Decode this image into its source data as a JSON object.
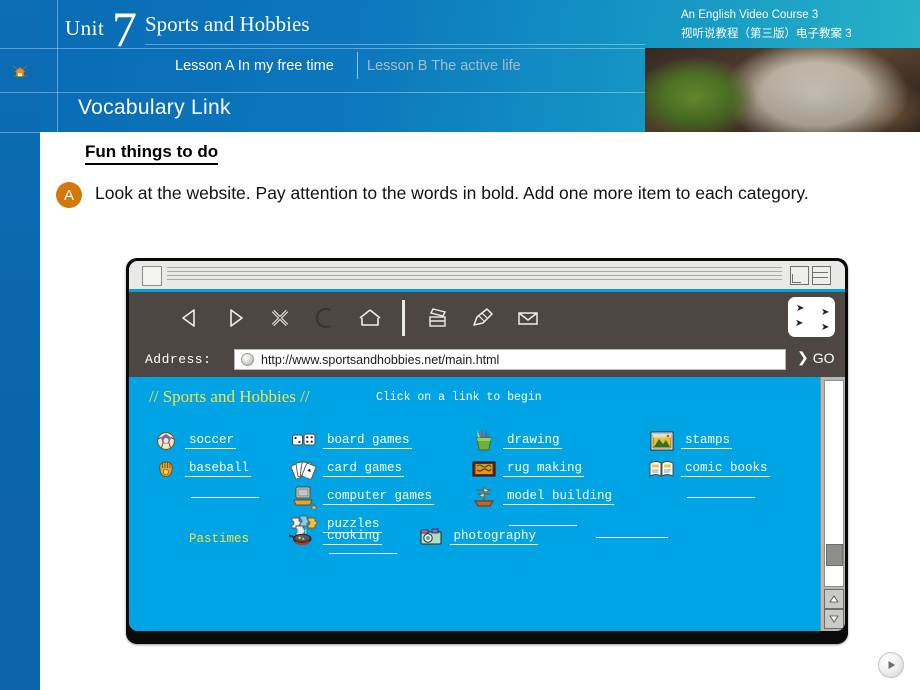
{
  "header": {
    "unit_word": "Unit",
    "unit_number": "7",
    "unit_title": "Sports and Hobbies",
    "lesson_a": "Lesson A  In my free time",
    "lesson_b": "Lesson B The active life",
    "course_en": "An English Video Course 3",
    "course_cn": "视听说教程（第三版）电子教案 3",
    "section_title": "Vocabulary Link",
    "home_icon": "home-icon",
    "accent_blue": "#0b6cb4",
    "accent_teal": "#27b3c6"
  },
  "body": {
    "heading": "Fun things to do ",
    "task_badge": "A",
    "instruction": "Look at the website. Pay attention to the words in bold. Add one more item to each category."
  },
  "browser": {
    "toolbar_icons": [
      "back-icon",
      "forward-icon",
      "stop-icon",
      "reload-icon",
      "home-icon",
      "print-icon",
      "edit-icon",
      "mail-icon"
    ],
    "address_label": "Address:",
    "address_value": "http://www.sportsandhobbies.net/main.html",
    "go_label": "GO",
    "minimize_icon": "minimize-icon",
    "maximize_icon": "maximize-icon",
    "scrollbar": {
      "up_arrow": "scroll-up-icon",
      "down_arrow": "scroll-down-icon"
    }
  },
  "page": {
    "title": "// Sports and Hobbies //",
    "hint": "Click on a link to begin",
    "pastimes_label": "Pastimes",
    "background_color": "#00a3e4",
    "title_color": "#f5e44a",
    "columns": [
      {
        "id": "sports",
        "items": [
          {
            "icon": "soccer-ball-icon",
            "label": " soccer"
          },
          {
            "icon": "baseball-glove-icon",
            "label": "baseball"
          }
        ],
        "blank": true
      },
      {
        "id": "games",
        "items": [
          {
            "icon": "dice-icon",
            "label": " board games"
          },
          {
            "icon": "playing-cards-icon",
            "label": " card games"
          },
          {
            "icon": "computer-icon",
            "label": "computer games"
          },
          {
            "icon": "puzzle-pieces-icon",
            "label": "puzzles"
          }
        ],
        "blank": true
      },
      {
        "id": "crafts",
        "items": [
          {
            "icon": "colored-pencils-icon",
            "label": "drawing"
          },
          {
            "icon": "rug-icon",
            "label": " rug making"
          },
          {
            "icon": "model-ship-icon",
            "label": "model building"
          }
        ],
        "blank": true
      },
      {
        "id": "collecting",
        "items": [
          {
            "icon": "postage-stamp-icon",
            "label": " stamps"
          },
          {
            "icon": "comic-book-icon",
            "label": " comic books"
          }
        ],
        "blank": true
      }
    ],
    "bottom_items": [
      {
        "icon": "frying-pan-icon",
        "label": "cooking"
      },
      {
        "icon": "camera-icon",
        "label": "photography"
      }
    ]
  },
  "footer": {
    "play_icon": "play-icon"
  }
}
